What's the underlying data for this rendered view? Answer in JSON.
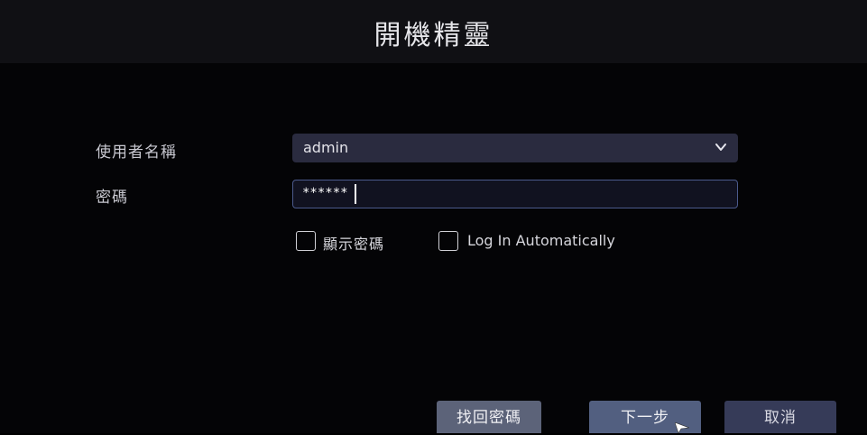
{
  "wizard": {
    "title": "開機精靈"
  },
  "form": {
    "username_label": "使用者名稱",
    "username_value": "admin",
    "password_label": "密碼",
    "password_value": "******",
    "show_password_label": "顯示密碼",
    "auto_login_label": "Log In Automatically"
  },
  "buttons": {
    "recover_label": "找回密碼",
    "next_label": "下一步",
    "cancel_label": "取消"
  },
  "icons": {
    "dropdown": "chevron-down-icon",
    "pointer": "mouse-pointer-icon"
  },
  "colors": {
    "background": "#040406",
    "title_bar": "#101014",
    "select_bg": "#2a2b3f",
    "input_border": "#4b5a8c",
    "button_primary": "#525f80",
    "button_secondary": "#5c6379",
    "button_cancel": "#363b58"
  }
}
